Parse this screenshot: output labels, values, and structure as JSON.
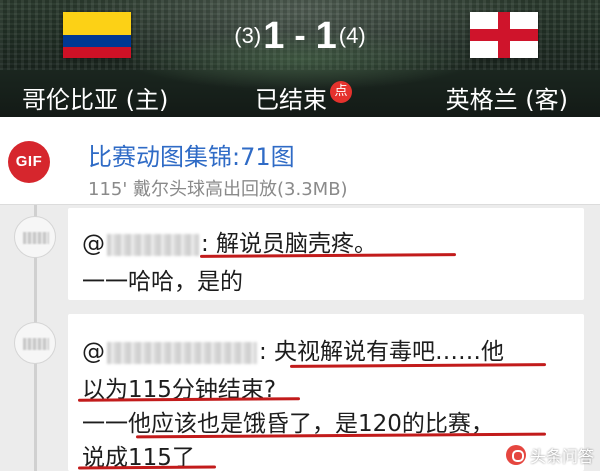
{
  "match": {
    "home_team": "哥伦比亚 (主)",
    "away_team": "英格兰 (客)",
    "home_penalty": "(3)",
    "home_goals": "1",
    "dash": "-",
    "away_goals": "1",
    "away_penalty": "(4)",
    "status": "已结束",
    "status_badge": "点",
    "home_flag": "colombia-flag",
    "away_flag": "england-flag"
  },
  "highlights": {
    "icon_label": "GIF",
    "title": "比赛动图集锦:71图",
    "subtitle": "115' 戴尔头球高出回放(3.3MB)"
  },
  "comments": [
    {
      "mention": "@",
      "text": ": 解说员脑壳疼。",
      "reply": "一一哈哈，是的"
    },
    {
      "mention": "@",
      "text": ": 央视解说有毒吧……他",
      "line2": "以为115分钟结束?",
      "line3": "一一他应该也是饿昏了，是120的比赛，",
      "line4": "说成115了"
    }
  ],
  "watermark": "头条问答",
  "colors": {
    "accent_blue": "#2f6bc6",
    "gif_red": "#d6262d",
    "underline_red": "#c21b1b",
    "badge_red": "#e5322d"
  }
}
